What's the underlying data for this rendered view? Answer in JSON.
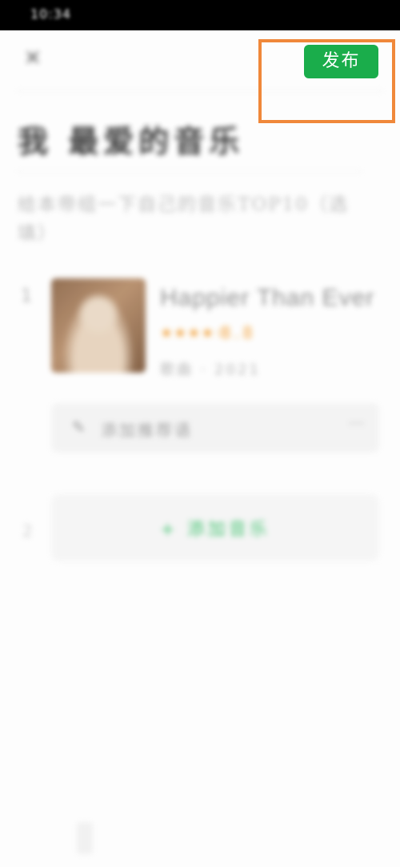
{
  "status_bar": {
    "time": "10:34"
  },
  "header": {
    "close_icon": "close-icon",
    "publish_label": "发布"
  },
  "page": {
    "title": "我 最爱的音乐",
    "subtitle": "给本帝组一下自己的音乐TOP10（选填）"
  },
  "music_list": [
    {
      "rank": "1",
      "title": "Happier Than Ever",
      "stars": "★★★★☆",
      "rating": "8.8",
      "meta": "歌曲 · 2021"
    }
  ],
  "comment": {
    "icon": "pen-icon",
    "placeholder": "添加推荐语",
    "more": "···"
  },
  "add_music": {
    "rank": "2",
    "label": "+ 添加音乐"
  },
  "colors": {
    "accent": "#1aad4b",
    "highlight": "#f0883a"
  }
}
